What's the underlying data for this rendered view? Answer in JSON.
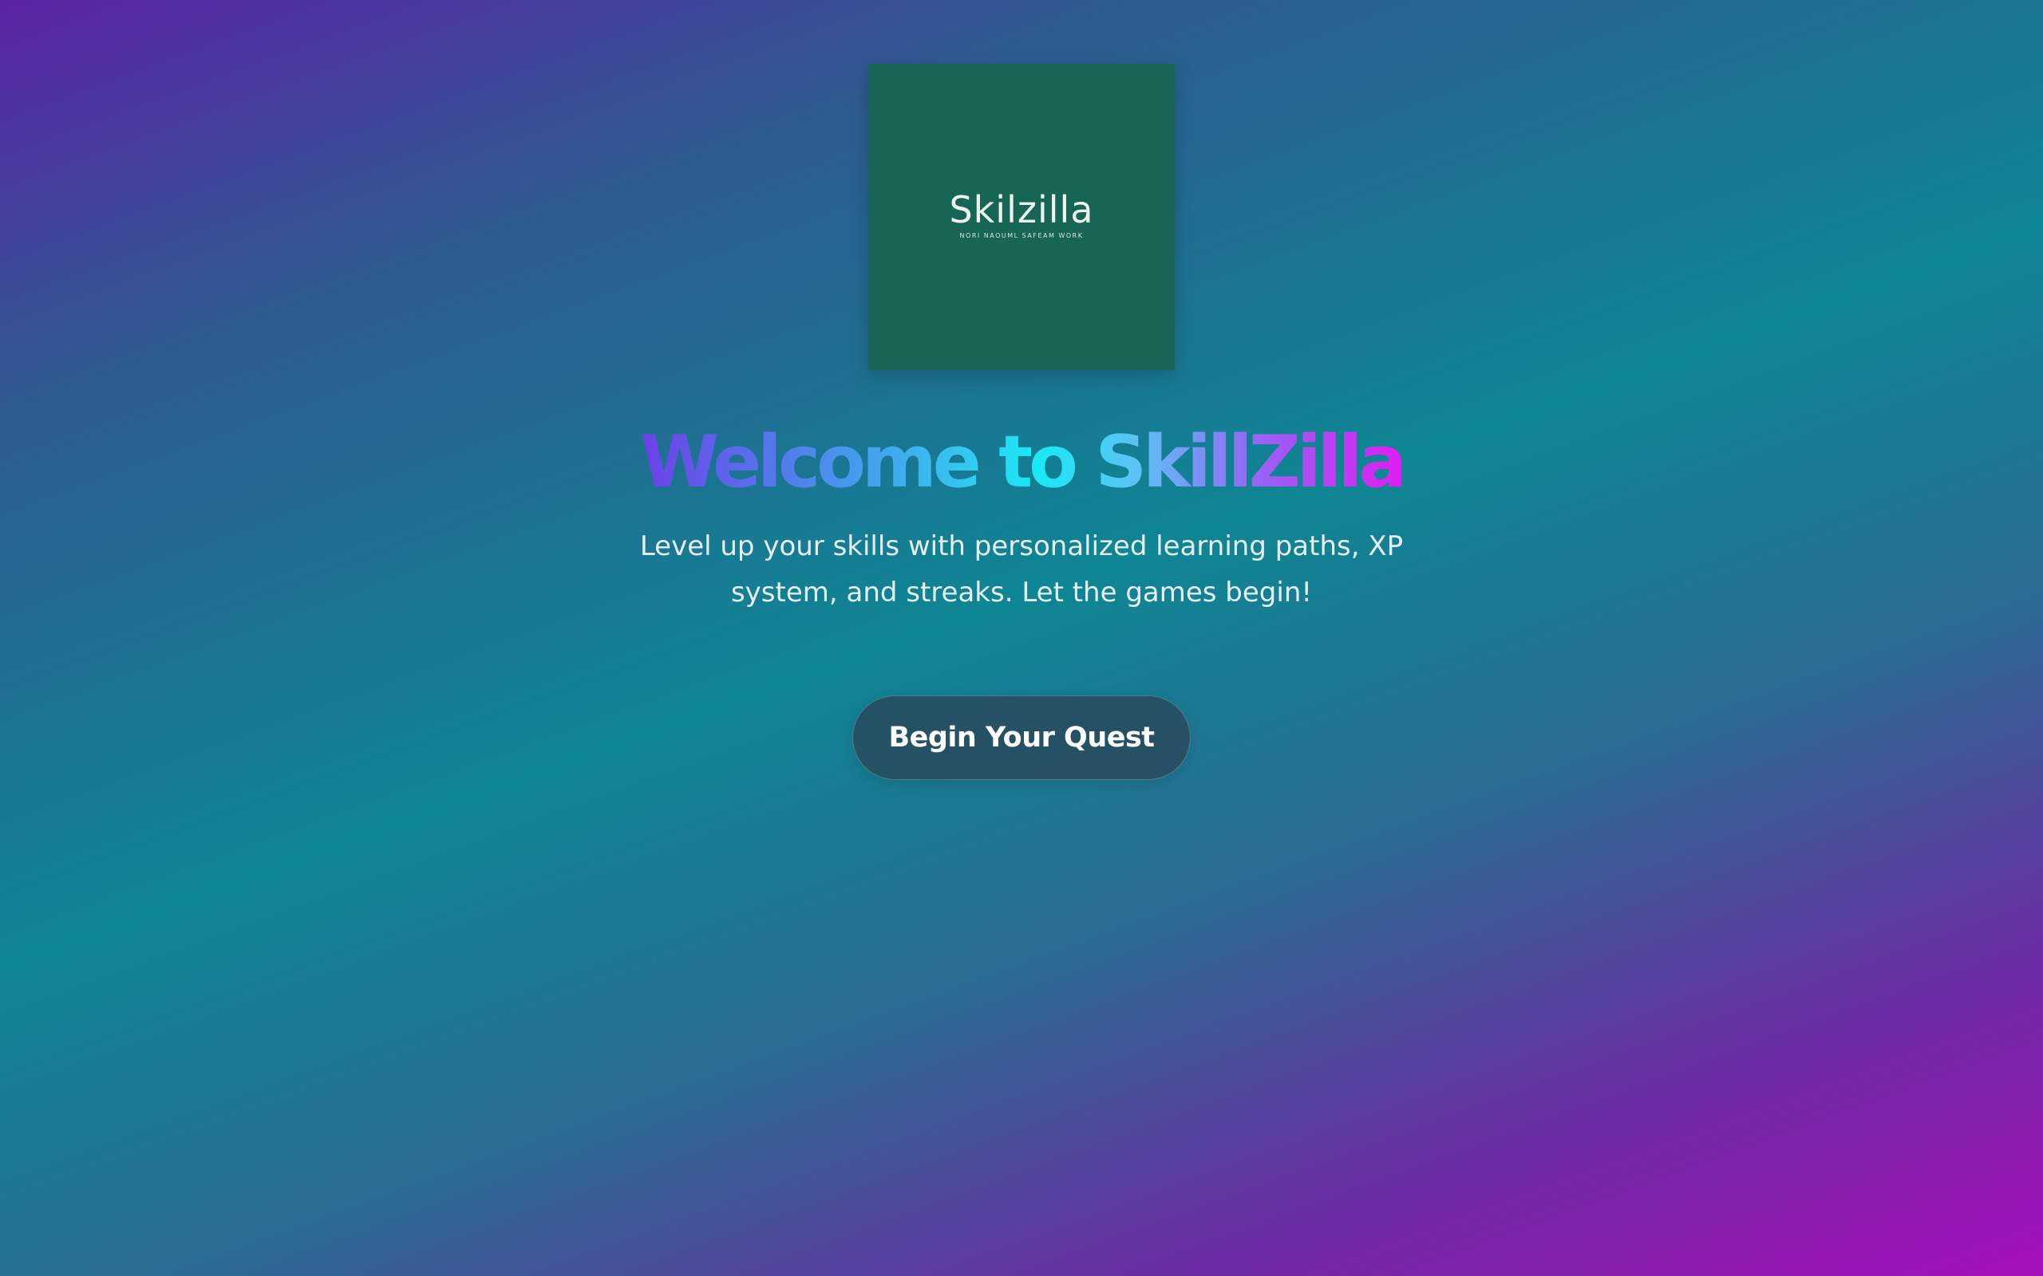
{
  "logo": {
    "text": "Skilzilla",
    "tagline": "NORI NAOUML SAFEAM WORK"
  },
  "hero": {
    "title": "Welcome to SkillZilla",
    "subtitle": "Level up your skills with personalized learning paths, XP system, and streaks. Let the games begin!",
    "cta_label": "Begin Your Quest"
  },
  "colors": {
    "background_start": "#5b23a6",
    "background_mid": "#0e8693",
    "background_end": "#a60fbb",
    "logo_card": "#176655",
    "title_gradient_start": "#6d40e8",
    "title_gradient_mid": "#17e9f5",
    "title_gradient_end": "#de1ff2",
    "button_bg": "#28485c"
  }
}
